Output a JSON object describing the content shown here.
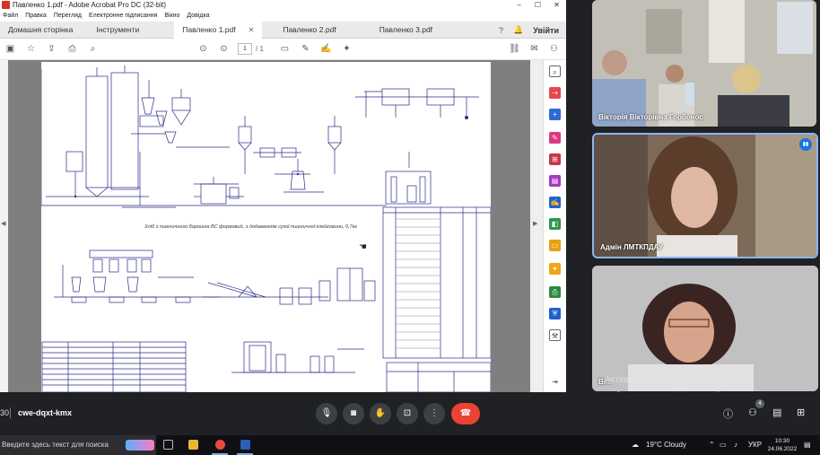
{
  "acrobat": {
    "title": "Павленко 1.pdf - Adobe Acrobat Pro DC (32-bit)",
    "menu": [
      "Файл",
      "Правка",
      "Перегляд",
      "Електронне підписання",
      "Вікно",
      "Довідка"
    ],
    "tabs": [
      {
        "label": "Домашня сторінка"
      },
      {
        "label": "Інструменти"
      },
      {
        "label": "Павленко 1.pdf",
        "active": true
      },
      {
        "label": "Павленко 2.pdf"
      },
      {
        "label": "Павленко 3.pdf"
      }
    ],
    "login_label": "Увійти",
    "page": {
      "current": "1",
      "total": "/ 1"
    },
    "drawing": {
      "caption": "Хліб з пшеничного борошна ВС формовий, з додаванням сухої пшеничної клейковини, 0,7кг"
    }
  },
  "meet": {
    "participants": [
      {
        "name": "Вікторія Вікторівна Горбонос"
      },
      {
        "name": "Адмін ЛМТКПДАУ",
        "speaking": true
      },
      {
        "name": "Ві..."
      }
    ],
    "watermark_title": "Активация Windows",
    "watermark_text": "Чтобы активировать Windows, перейдите в раздел \"Параметры\".",
    "time_fragment": "30",
    "meeting_code": "cwe-dqxt-kmx",
    "people_count": "4"
  },
  "taskbar": {
    "search_placeholder": "Введите здесь текст для поиска",
    "weather": "19°C  Cloudy",
    "language": "УКР",
    "time": "10:30",
    "date": "24.06.2022"
  },
  "colors": {
    "meet_bg": "#202124",
    "end_call": "#ea4335",
    "speaking_border": "#8ab4f8",
    "acrobat_red": "#d9302b"
  }
}
